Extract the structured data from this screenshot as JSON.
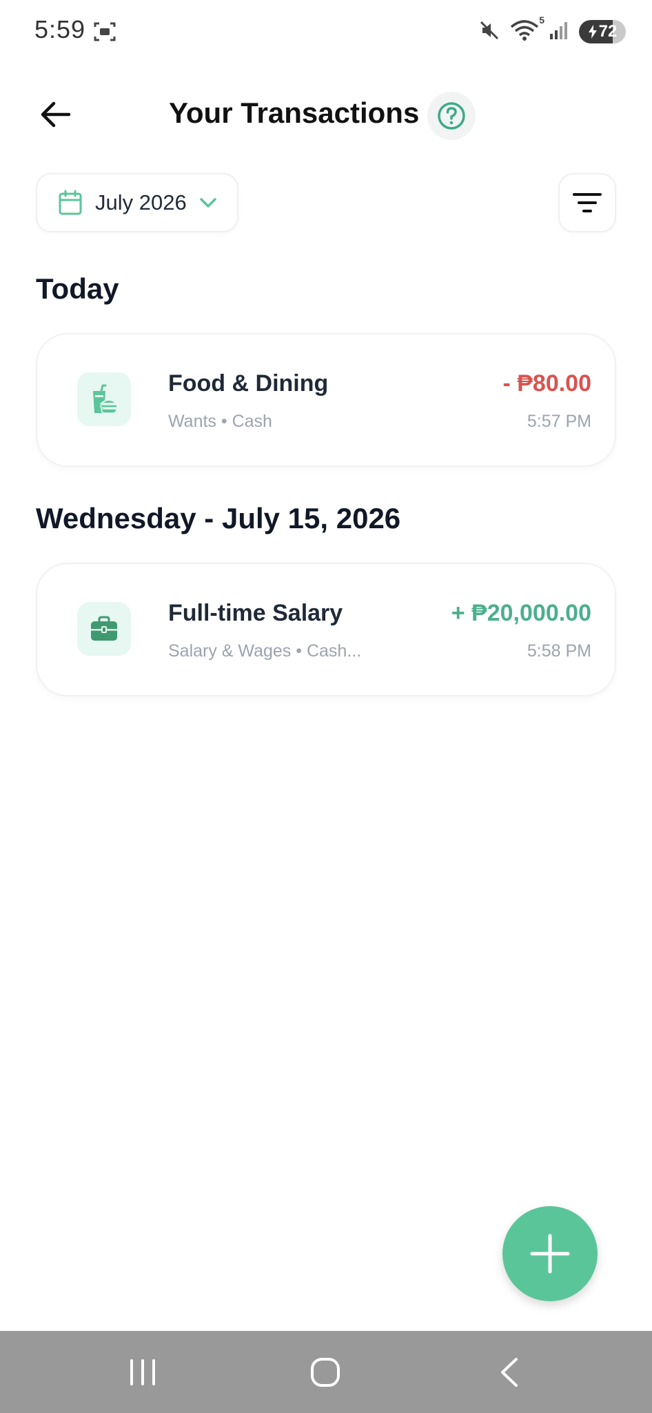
{
  "status_bar": {
    "time": "5:59",
    "signal_badge": "5",
    "battery_level": "72",
    "battery_fraction": 0.72,
    "icons": [
      "screenshot-icon",
      "mute-icon",
      "wifi-icon",
      "signal-icon",
      "battery-icon"
    ]
  },
  "header": {
    "title": "Your Transactions",
    "back_icon": "arrow-left-icon",
    "help_icon": "question-circle-icon"
  },
  "filters": {
    "month_label": "July 2026",
    "calendar_icon": "calendar-icon",
    "dropdown_icon": "chevron-down-icon",
    "filter_icon": "filter-icon"
  },
  "sections": [
    {
      "heading": "Today",
      "transactions": [
        {
          "title": "Food & Dining",
          "subtitle": "Wants • Cash",
          "amount": "- ₱80.00",
          "time": "5:57 PM",
          "type": "expense",
          "icon": "food-dining-icon"
        }
      ]
    },
    {
      "heading": "Wednesday - July 15, 2026",
      "transactions": [
        {
          "title": "Full-time Salary",
          "subtitle": "Salary & Wages • Cash...",
          "amount": "+ ₱20,000.00",
          "time": "5:58 PM",
          "type": "income",
          "icon": "briefcase-icon"
        }
      ]
    }
  ],
  "fab": {
    "icon": "plus-icon"
  },
  "nav_bar": {
    "icons": [
      "recent-apps-icon",
      "home-icon",
      "back-icon"
    ]
  },
  "colors": {
    "accent": "#5bc59a",
    "expense": "#d9534f",
    "income": "#4caf8f",
    "icon_bg": "#e7f7f1",
    "muted": "#9ca3af"
  }
}
